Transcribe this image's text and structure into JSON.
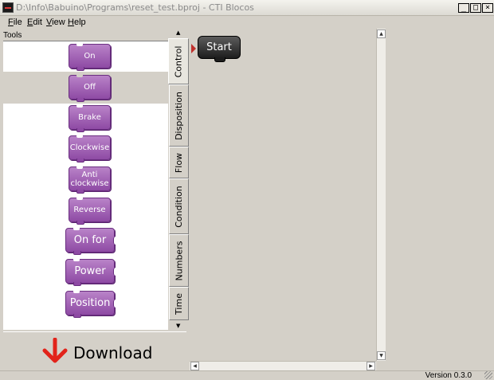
{
  "window": {
    "title": "D:\\Info\\Babuino\\Programs\\reset_test.bproj - CTI Blocos",
    "minimize": "_",
    "maximize": "□",
    "close": "×"
  },
  "menu": [
    {
      "mnemonic": "F",
      "rest": "ile"
    },
    {
      "mnemonic": "E",
      "rest": "dit"
    },
    {
      "mnemonic": "V",
      "rest": "iew"
    },
    {
      "mnemonic": "H",
      "rest": "elp"
    }
  ],
  "tools": {
    "label": "Tools",
    "blocks": [
      {
        "label": "On",
        "size": "small"
      },
      {
        "label": "Off",
        "size": "small"
      },
      {
        "label": "Brake",
        "size": "small"
      },
      {
        "label": "Clockwise",
        "size": "small"
      },
      {
        "label": "Anti clockwise",
        "size": "small"
      },
      {
        "label": "Reverse",
        "size": "small"
      },
      {
        "label": "On for",
        "size": "big"
      },
      {
        "label": "Power",
        "size": "big"
      },
      {
        "label": "Position",
        "size": "big"
      }
    ]
  },
  "tabs": [
    {
      "label": "Control",
      "active": true
    },
    {
      "label": "Disposition",
      "active": false
    },
    {
      "label": "Flow",
      "active": false
    },
    {
      "label": "Condition",
      "active": false
    },
    {
      "label": "Numbers",
      "active": false
    },
    {
      "label": "Time",
      "active": false
    }
  ],
  "download": {
    "label": "Download",
    "icon": "down-arrow-icon"
  },
  "canvas": {
    "start_label": "Start"
  },
  "status": {
    "version": "Version 0.3.0"
  },
  "colors": {
    "block_purple": "#9b59b6",
    "start_black": "#2a2a2a",
    "download_arrow": "#e2231a"
  }
}
